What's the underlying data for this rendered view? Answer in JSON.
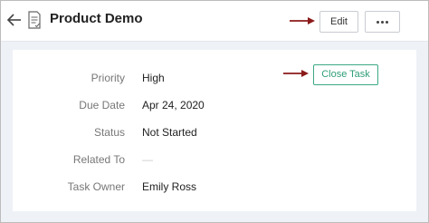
{
  "header": {
    "back_icon": "arrow-left-icon",
    "record_icon": "task-document-icon",
    "title": "Product Demo",
    "edit_label": "Edit",
    "more_icon": "more-dots-icon"
  },
  "details": {
    "close_task_label": "Close Task",
    "fields": [
      {
        "label": "Priority",
        "value": "High"
      },
      {
        "label": "Due Date",
        "value": "Apr 24, 2020"
      },
      {
        "label": "Status",
        "value": "Not Started"
      },
      {
        "label": "Related To",
        "value": "—"
      },
      {
        "label": "Task Owner",
        "value": "Emily Ross"
      }
    ]
  },
  "annotation_color": "#8b1a1a",
  "accent_color": "#2f9e78"
}
